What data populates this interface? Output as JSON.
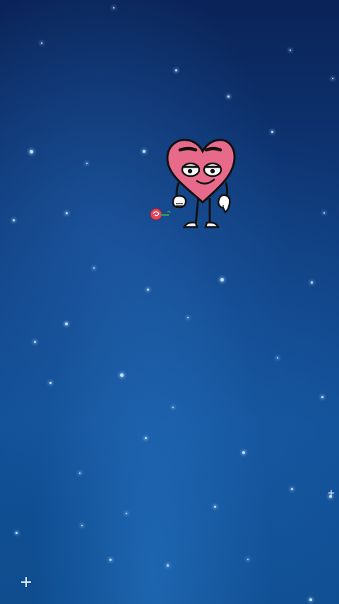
{
  "scene": {
    "background": "starry-night-sky",
    "colors": {
      "sky_top": "#0a2358",
      "sky_bottom": "#125096",
      "heart": "#e86a8a",
      "outline": "#111111",
      "rose": "#e2475f",
      "stem": "#3aa050"
    },
    "character": {
      "icon": "heart-character-icon",
      "holding": "rose-icon"
    }
  }
}
